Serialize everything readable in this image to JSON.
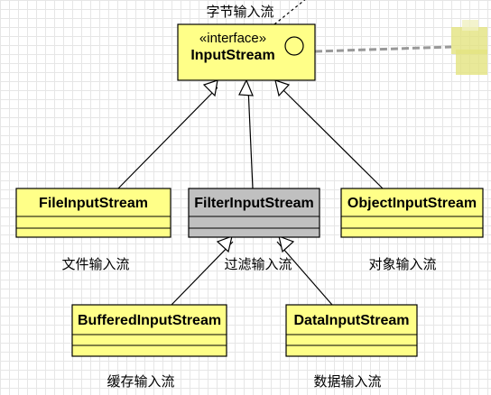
{
  "diagram": {
    "top_caption": "字节输入流",
    "interface": {
      "stereotype": "«interface»",
      "name": "InputStream"
    },
    "classes": [
      {
        "name": "FileInputStream",
        "caption": "文件输入流"
      },
      {
        "name": "FilterInputStream",
        "caption": "过滤输入流"
      },
      {
        "name": "ObjectInputStream",
        "caption": "对象输入流"
      },
      {
        "name": "BufferedInputStream",
        "caption": "缓存输入流"
      },
      {
        "name": "DataInputStream",
        "caption": "数据输入流"
      }
    ],
    "colors": {
      "class_fill": "#ffff88",
      "abstract_fill": "#c0c0c0",
      "stroke": "#000000",
      "grid": "#e6e6e6"
    }
  }
}
